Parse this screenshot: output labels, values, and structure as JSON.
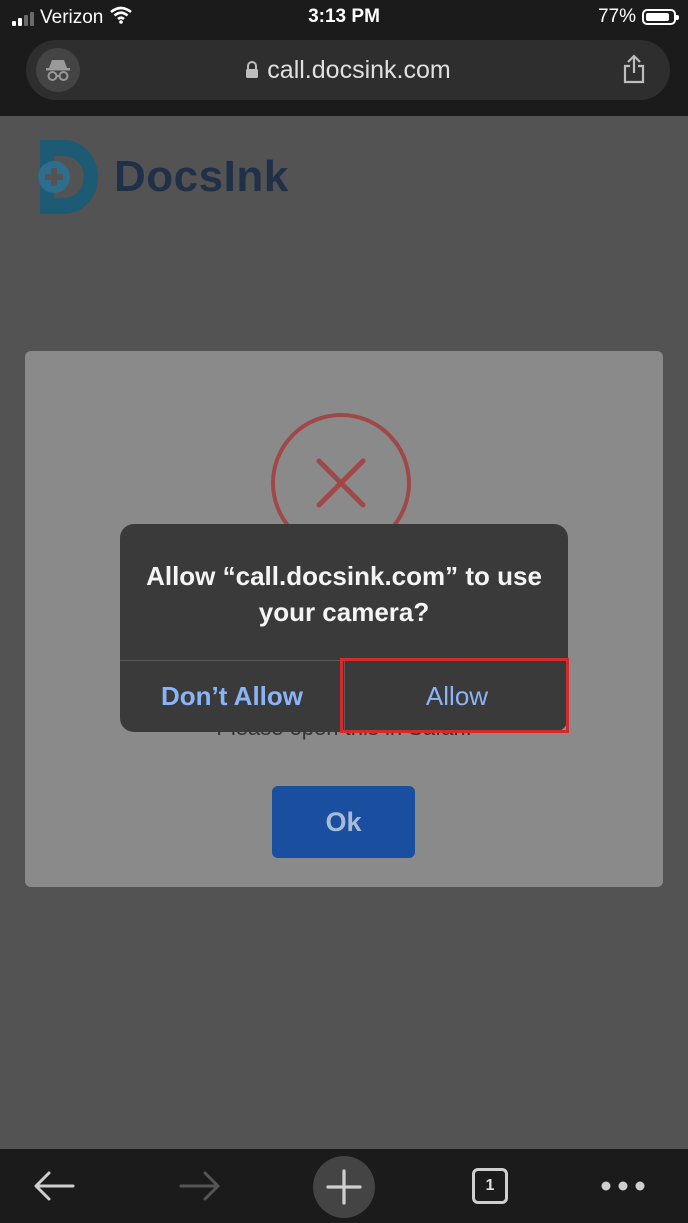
{
  "status_bar": {
    "carrier": "Verizon",
    "time": "3:13 PM",
    "battery_percent": "77%",
    "battery_level": 0.77
  },
  "browser": {
    "url": "call.docsink.com",
    "open_tabs": "1"
  },
  "page": {
    "logo_text": "DocsInk",
    "error_message": "Please open this in Safari.",
    "ok_label": "Ok"
  },
  "permission_dialog": {
    "title": "Allow “call.docsink.com” to use your camera?",
    "deny_label": "Don’t Allow",
    "allow_label": "Allow"
  },
  "colors": {
    "dialog_button_text": "#8ab4f8",
    "highlight_border": "#d42a2a",
    "ok_button": "#1a4e9e",
    "error_icon": "#a04848"
  }
}
